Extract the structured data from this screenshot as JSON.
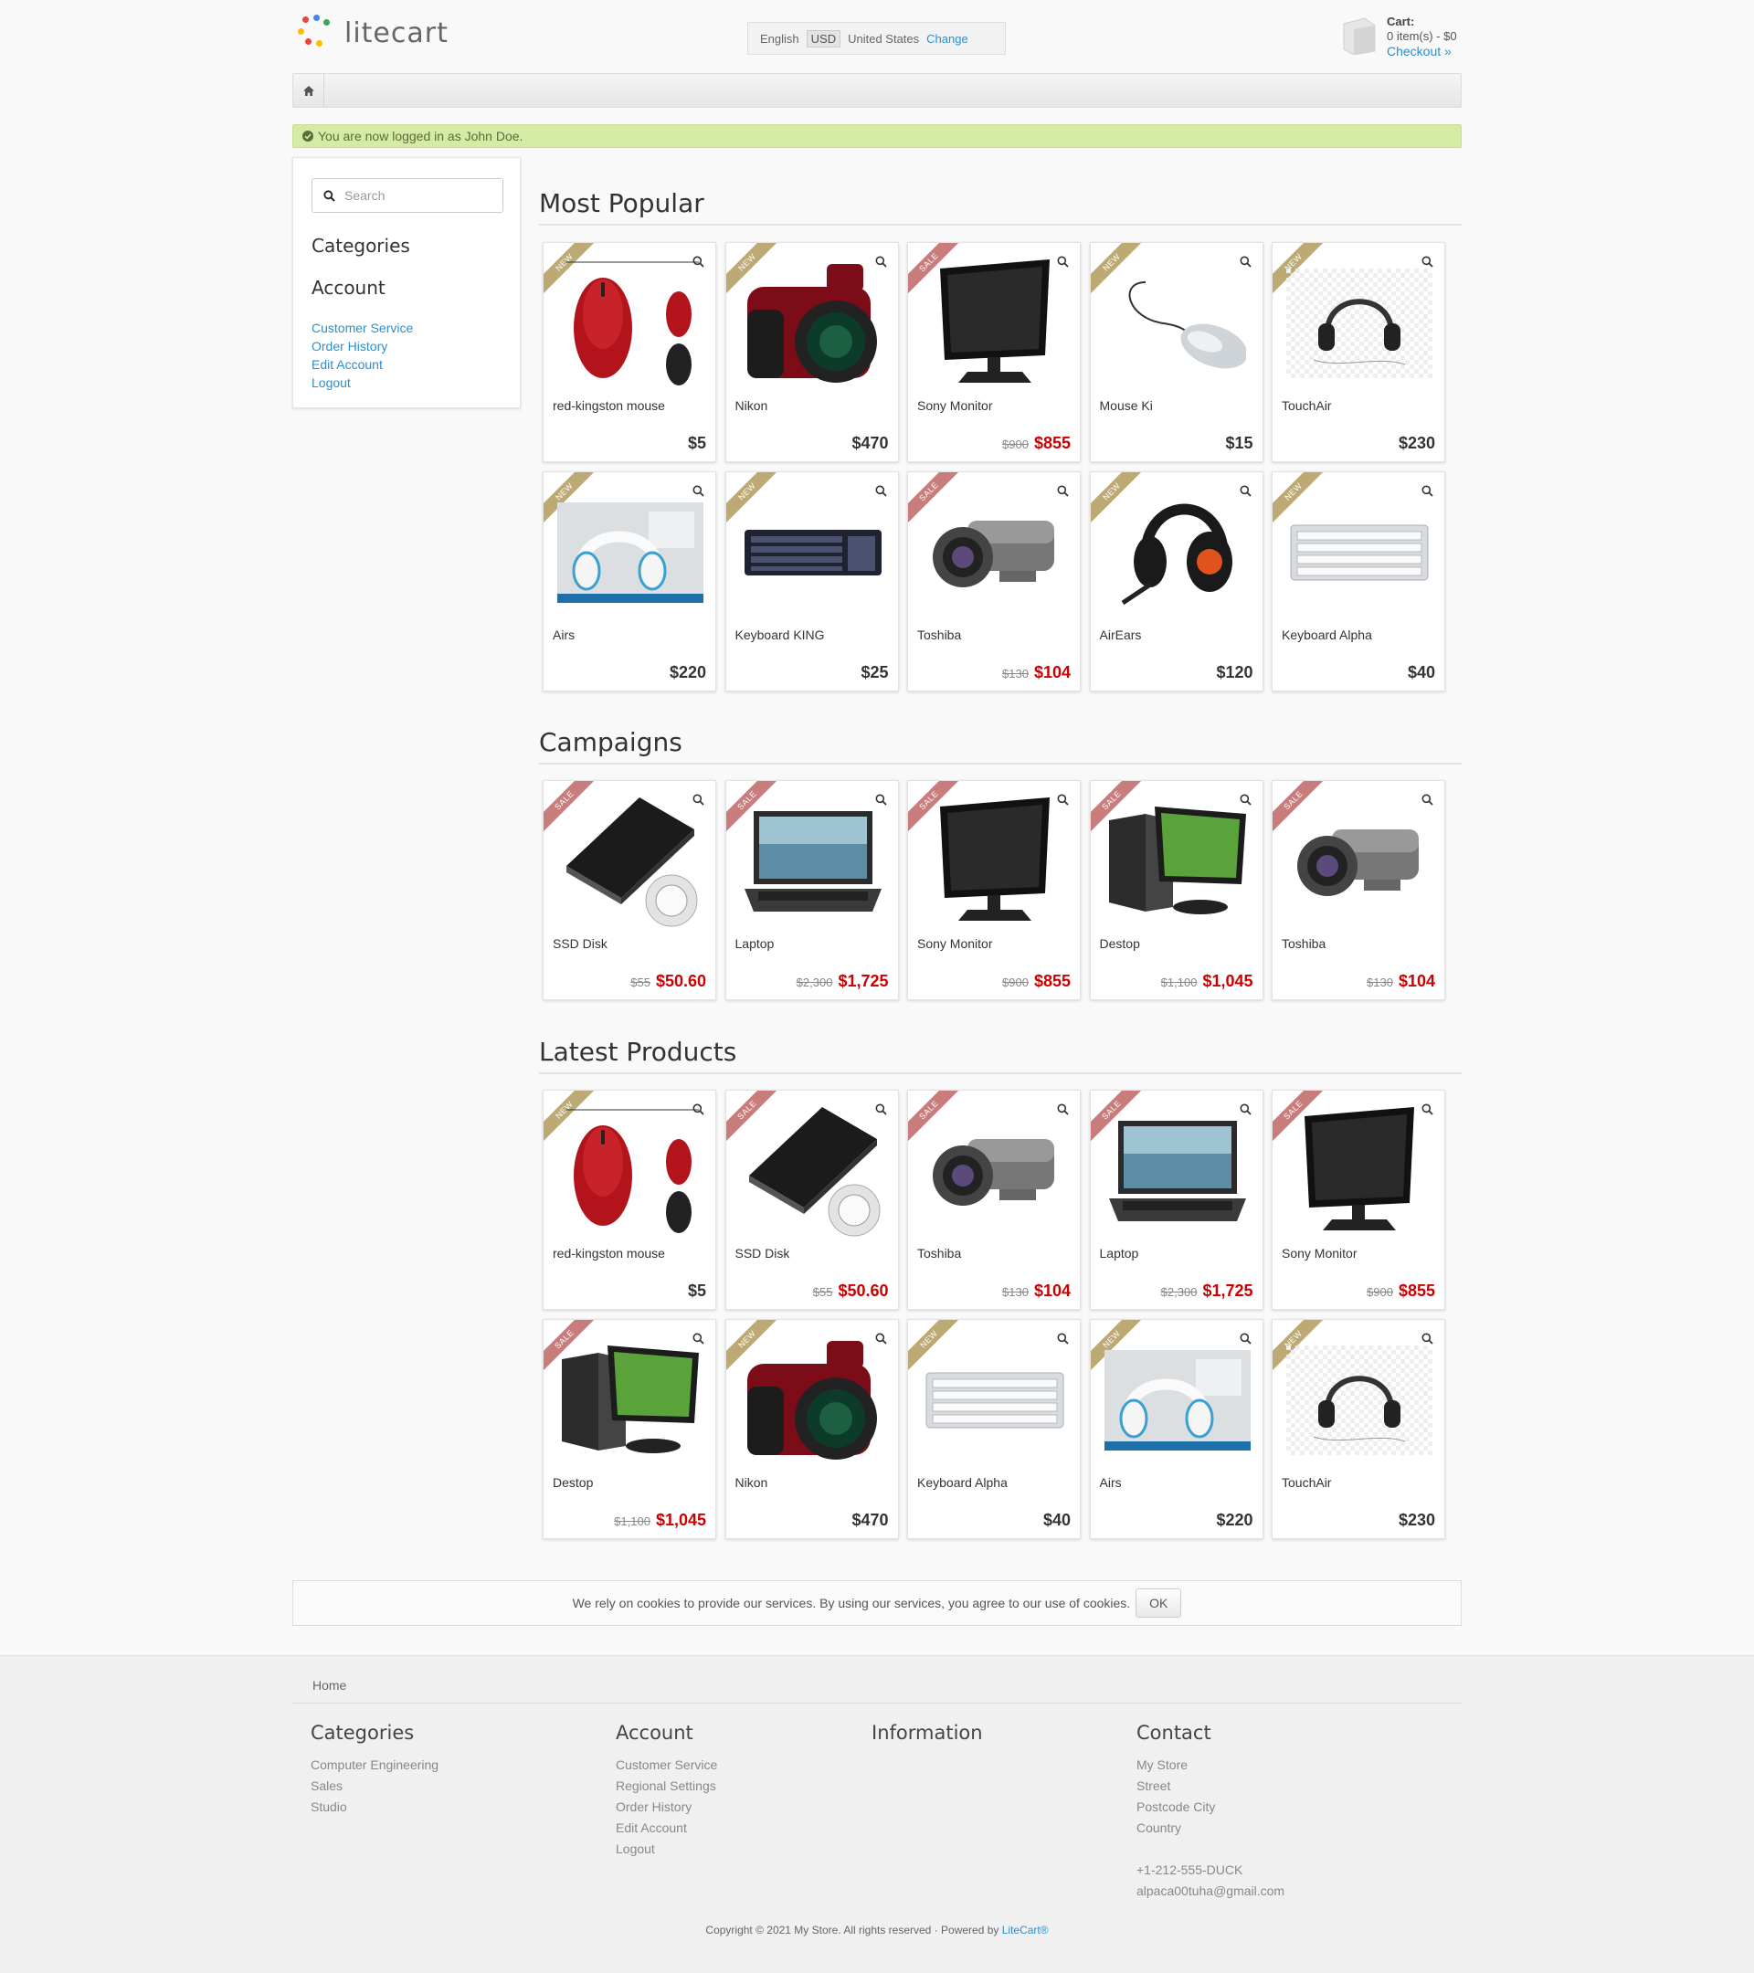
{
  "header": {
    "logo_text": "litecart",
    "language": "English",
    "currency": "USD",
    "country": "United States",
    "change_label": "Change",
    "cart_label": "Cart:",
    "cart_summary": "0 item(s) - $0",
    "checkout_label": "Checkout »"
  },
  "notice": "You are now logged in as John Doe.",
  "sidebar": {
    "search_placeholder": "Search",
    "categories_title": "Categories",
    "account_title": "Account",
    "account_links": [
      "Customer Service",
      "Order History",
      "Edit Account",
      "Logout"
    ]
  },
  "sections": {
    "popular_title": "Most Popular",
    "campaigns_title": "Campaigns",
    "latest_title": "Latest Products"
  },
  "popular": [
    {
      "ribbon": "NEW",
      "name": "red-kingston mouse",
      "price": "$5",
      "icon": "mouse-red"
    },
    {
      "ribbon": "NEW",
      "name": "Nikon",
      "price": "$470",
      "icon": "camera"
    },
    {
      "ribbon": "SALE",
      "name": "Sony Monitor",
      "old": "$900",
      "price": "$855",
      "icon": "monitor"
    },
    {
      "ribbon": "NEW",
      "name": "Mouse Ki",
      "price": "$15",
      "icon": "mouse-silver"
    },
    {
      "ribbon": "NEW",
      "name": "TouchAir",
      "price": "$230",
      "icon": "headphones"
    },
    {
      "ribbon": "NEW",
      "name": "Airs",
      "price": "$220",
      "icon": "headphones-white"
    },
    {
      "ribbon": "NEW",
      "name": "Keyboard KING",
      "price": "$25",
      "icon": "keyboard-black"
    },
    {
      "ribbon": "SALE",
      "name": "Toshiba",
      "old": "$130",
      "price": "$104",
      "icon": "camcorder"
    },
    {
      "ribbon": "NEW",
      "name": "AirEars",
      "price": "$120",
      "icon": "headset"
    },
    {
      "ribbon": "NEW",
      "name": "Keyboard Alpha",
      "price": "$40",
      "icon": "keyboard-white"
    }
  ],
  "campaigns": [
    {
      "ribbon": "SALE",
      "name": "SSD Disk",
      "old": "$55",
      "price": "$50.60",
      "icon": "ssd"
    },
    {
      "ribbon": "SALE",
      "name": "Laptop",
      "old": "$2,300",
      "price": "$1,725",
      "icon": "laptop"
    },
    {
      "ribbon": "SALE",
      "name": "Sony Monitor",
      "old": "$900",
      "price": "$855",
      "icon": "monitor"
    },
    {
      "ribbon": "SALE",
      "name": "Destop",
      "old": "$1,100",
      "price": "$1,045",
      "icon": "desktop"
    },
    {
      "ribbon": "SALE",
      "name": "Toshiba",
      "old": "$130",
      "price": "$104",
      "icon": "camcorder"
    }
  ],
  "latest": [
    {
      "ribbon": "NEW",
      "name": "red-kingston mouse",
      "price": "$5",
      "icon": "mouse-red"
    },
    {
      "ribbon": "SALE",
      "name": "SSD Disk",
      "old": "$55",
      "price": "$50.60",
      "icon": "ssd"
    },
    {
      "ribbon": "SALE",
      "name": "Toshiba",
      "old": "$130",
      "price": "$104",
      "icon": "camcorder"
    },
    {
      "ribbon": "SALE",
      "name": "Laptop",
      "old": "$2,300",
      "price": "$1,725",
      "icon": "laptop"
    },
    {
      "ribbon": "SALE",
      "name": "Sony Monitor",
      "old": "$900",
      "price": "$855",
      "icon": "monitor"
    },
    {
      "ribbon": "SALE",
      "name": "Destop",
      "old": "$1,100",
      "price": "$1,045",
      "icon": "desktop"
    },
    {
      "ribbon": "NEW",
      "name": "Nikon",
      "price": "$470",
      "icon": "camera"
    },
    {
      "ribbon": "NEW",
      "name": "Keyboard Alpha",
      "price": "$40",
      "icon": "keyboard-white"
    },
    {
      "ribbon": "NEW",
      "name": "Airs",
      "price": "$220",
      "icon": "headphones-white"
    },
    {
      "ribbon": "NEW",
      "name": "TouchAir",
      "price": "$230",
      "icon": "headphones"
    }
  ],
  "cookie": {
    "text": "We rely on cookies to provide our services. By using our services, you agree to our use of cookies.",
    "ok_label": "OK"
  },
  "footer": {
    "breadcrumb_home": "Home",
    "categories_title": "Categories",
    "categories": [
      "Computer Engineering",
      "Sales",
      "Studio"
    ],
    "account_title": "Account",
    "account": [
      "Customer Service",
      "Regional Settings",
      "Order History",
      "Edit Account",
      "Logout"
    ],
    "information_title": "Information",
    "contact_title": "Contact",
    "contact_address": [
      "My Store",
      "Street",
      "Postcode City",
      "Country"
    ],
    "contact_phone": "+1-212-555-DUCK",
    "contact_email": "alpaca00tuha@gmail.com",
    "copyright": "Copyright © 2021 My Store. All rights reserved · Powered by ",
    "powered_link": "LiteCart®"
  },
  "colors": {
    "accent_link": "#2a8fd0",
    "sale_price": "#cc0000",
    "ribbon_new": "#bca974",
    "ribbon_sale": "#c97c7c",
    "notice_bg": "#d5eaa5"
  }
}
